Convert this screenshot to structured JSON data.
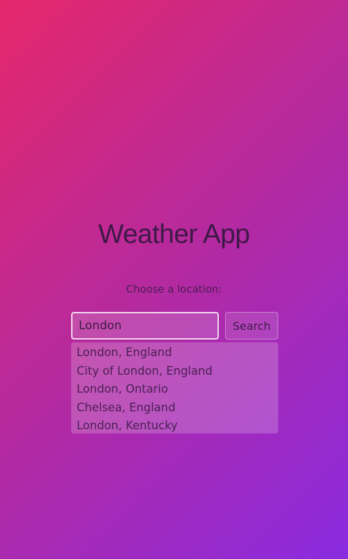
{
  "app": {
    "title": "Weather App"
  },
  "location": {
    "prompt": "Choose a location:",
    "input_value": "London",
    "button_label": "Search",
    "suggestions": [
      "London, England",
      "City of London, England",
      "London, Ontario",
      "Chelsea, England",
      "London, Kentucky"
    ]
  },
  "colors": {
    "gradient_start": "#e5286b",
    "gradient_mid": "#b52a9e",
    "gradient_end": "#8a2be0"
  }
}
